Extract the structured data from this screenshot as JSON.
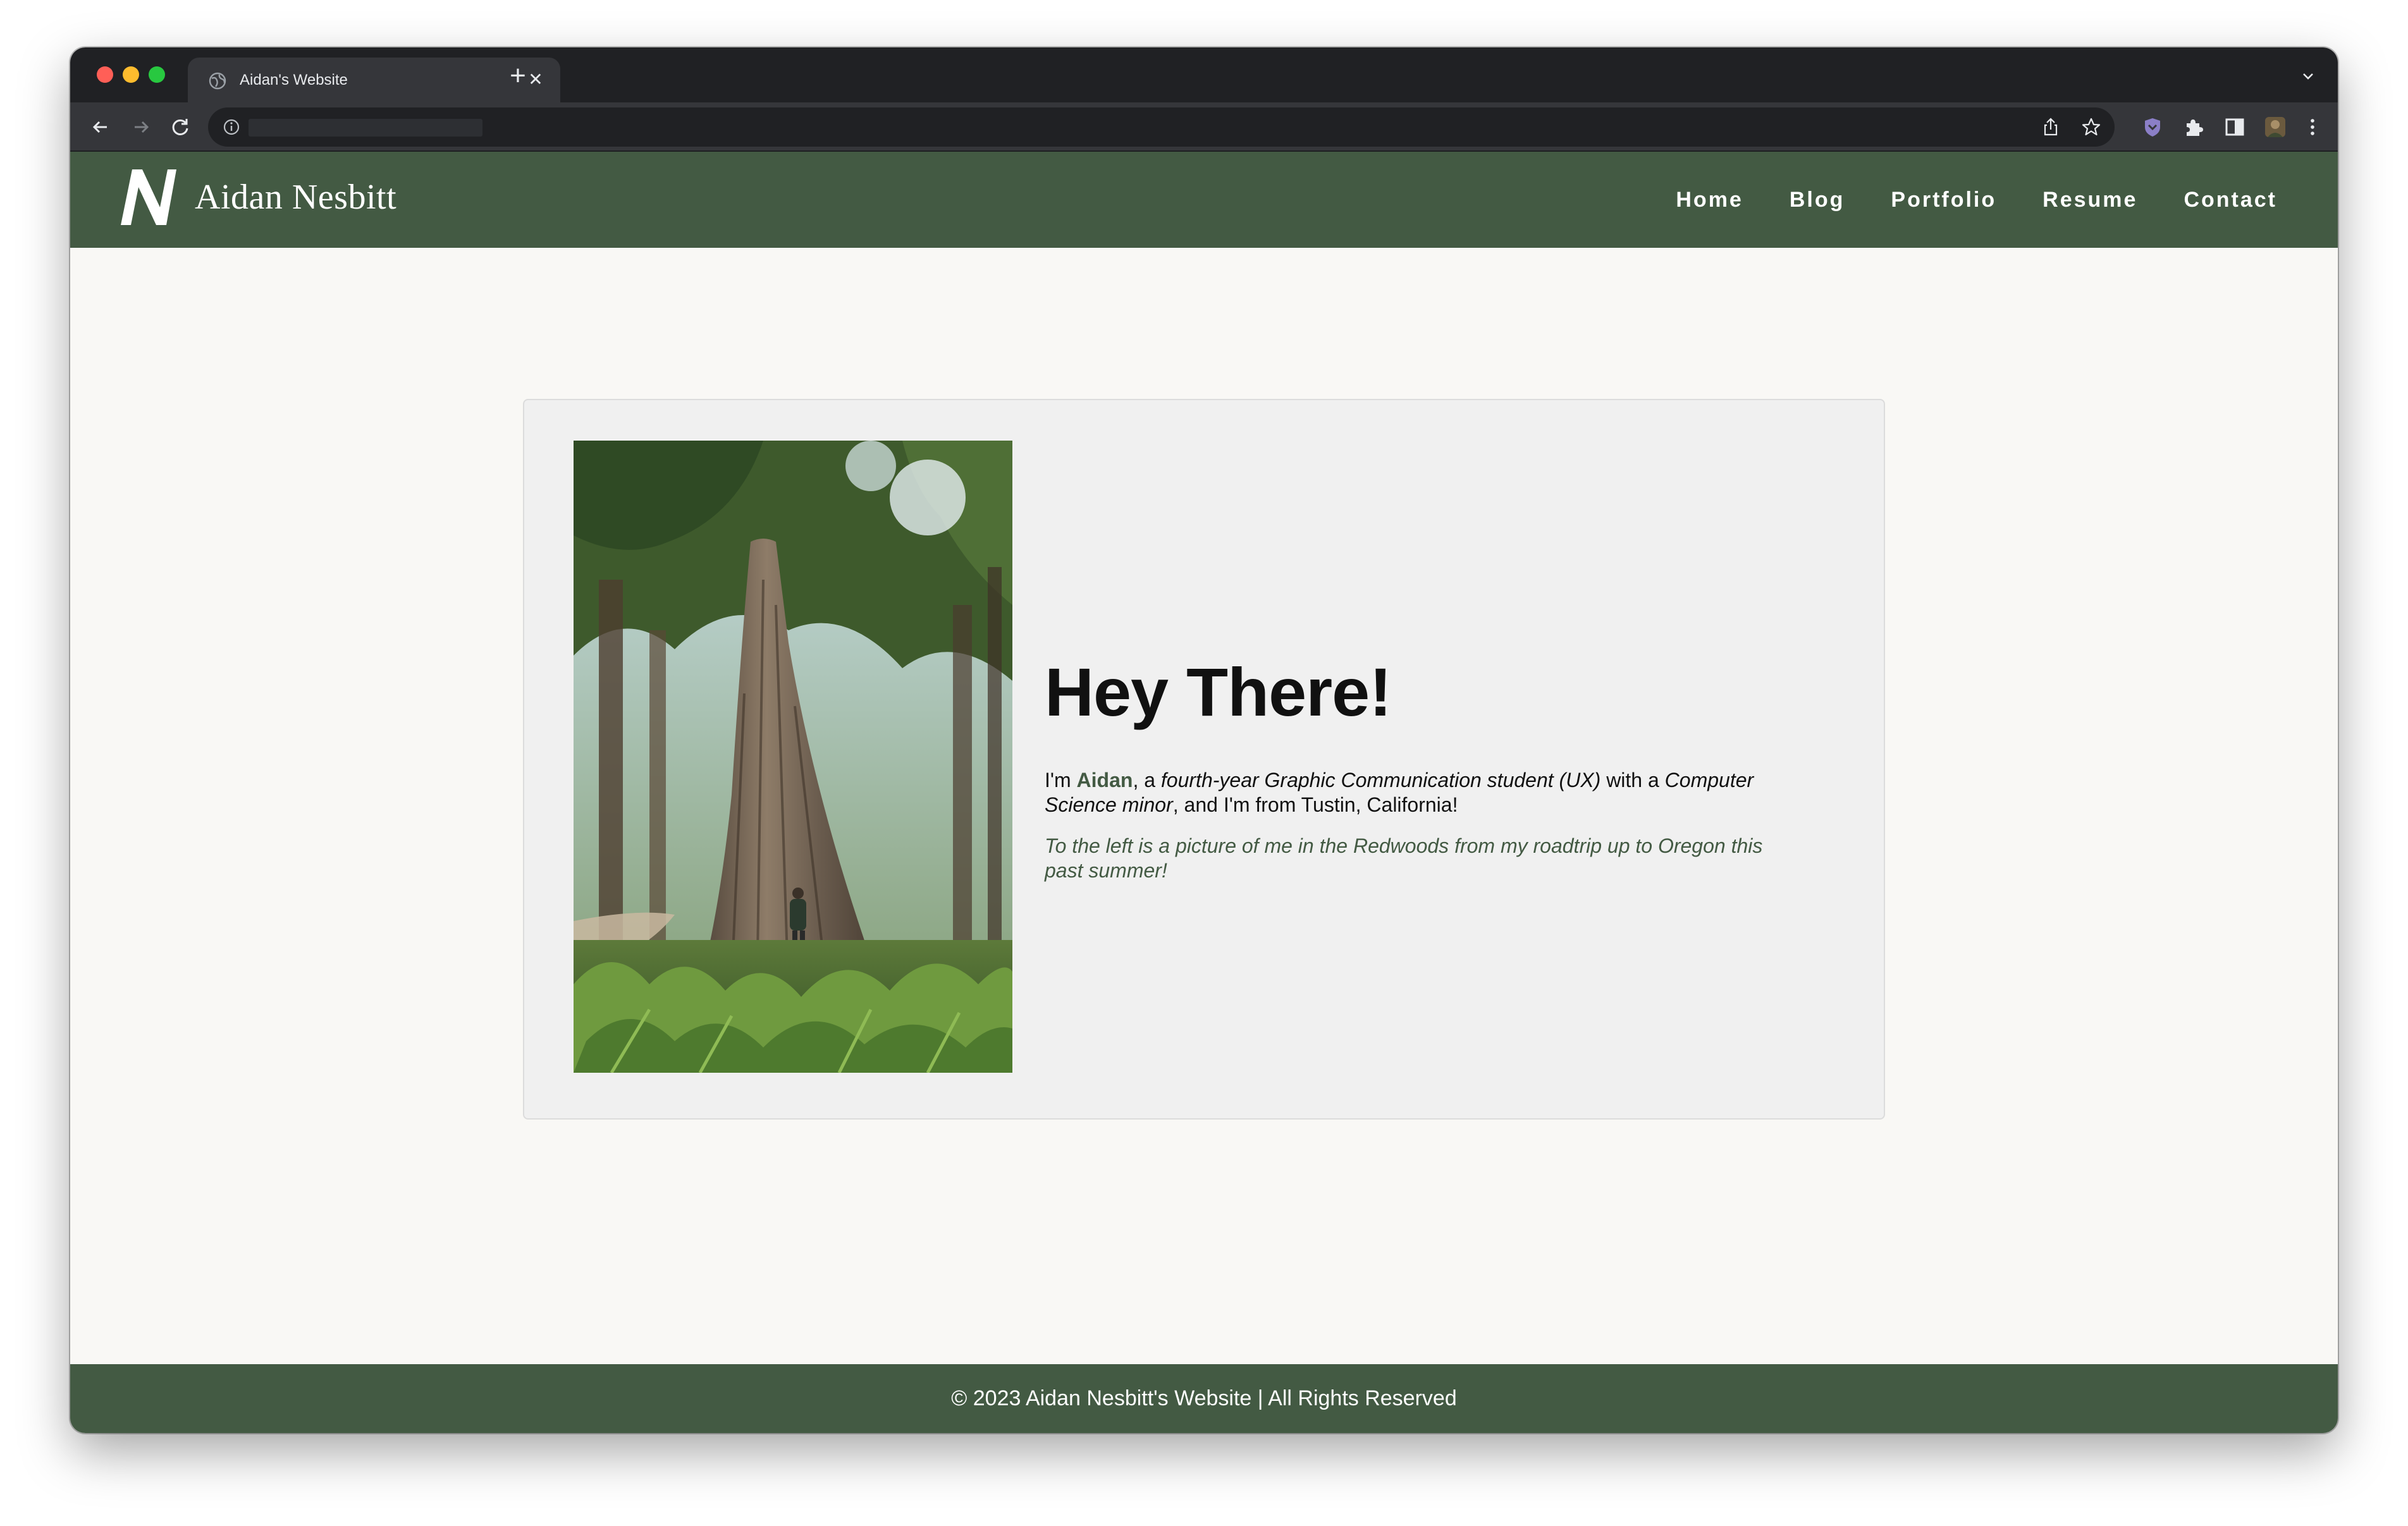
{
  "browser": {
    "tab_title": "Aidan's Website",
    "tab_close_icon": "close-icon",
    "new_tab_icon": "plus-icon",
    "url": ""
  },
  "site": {
    "logo_mark": "N",
    "logo_text": "Aidan Nesbitt",
    "nav": [
      "Home",
      "Blog",
      "Portfolio",
      "Resume",
      "Contact"
    ],
    "accent_color": "#435a43"
  },
  "hero": {
    "heading": "Hey There!",
    "intro": {
      "part1": "I'm ",
      "name": "Aidan",
      "part2": ", a ",
      "emph1": "fourth-year Graphic Communication student (UX)",
      "part3": " with a ",
      "emph2": "Computer Science minor",
      "part4": ", and I'm from Tustin, California!"
    },
    "caption": "To the left is a picture of me in the Redwoods from my roadtrip up to Oregon this past summer!"
  },
  "footer": {
    "text": "© 2023 Aidan Nesbitt's Website | All Rights Reserved"
  }
}
